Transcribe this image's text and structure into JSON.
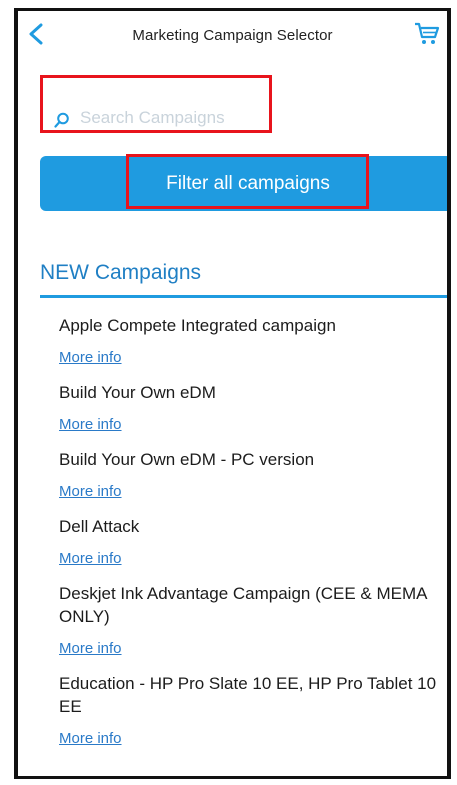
{
  "header": {
    "title": "Marketing Campaign Selector",
    "back_icon": "chevron-left-icon",
    "cart_icon": "cart-icon"
  },
  "search": {
    "placeholder": "Search Campaigns",
    "value": "",
    "icon": "search-icon"
  },
  "filter_button": {
    "label": "Filter all campaigns"
  },
  "section": {
    "title": "NEW Campaigns"
  },
  "campaigns": [
    {
      "title": "Apple Compete Integrated campaign",
      "link": "More info"
    },
    {
      "title": "Build Your Own eDM",
      "link": "More info"
    },
    {
      "title": "Build Your Own eDM - PC version",
      "link": "More info"
    },
    {
      "title": "Dell Attack",
      "link": "More info"
    },
    {
      "title": "Deskjet Ink Advantage Campaign (CEE & MEMA ONLY)",
      "link": "More info"
    },
    {
      "title": "Education - HP Pro Slate 10 EE, HP Pro Tablet 10 EE",
      "link": "More info"
    }
  ],
  "colors": {
    "accent": "#1f9be0",
    "highlight": "#e8141c",
    "link": "#2a7ac8"
  }
}
